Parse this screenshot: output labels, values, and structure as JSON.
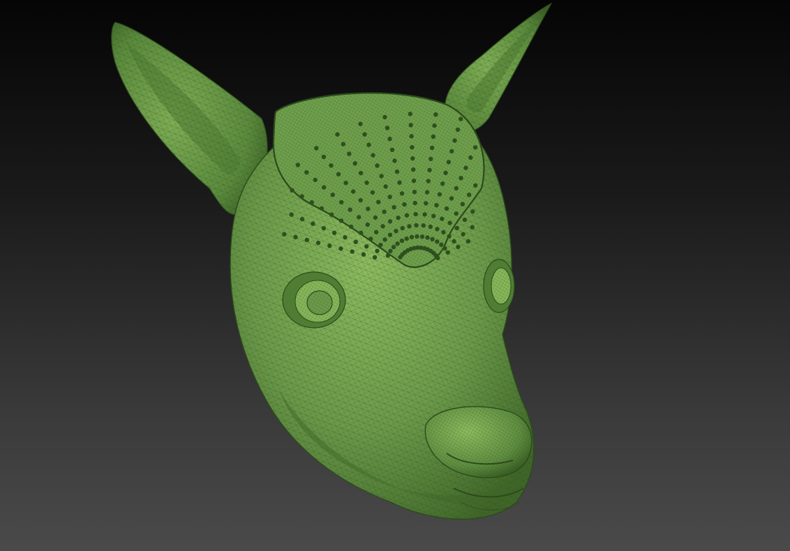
{
  "viewport": {
    "background_top": "#050505",
    "background_bottom": "#4a4a4a"
  },
  "model": {
    "subject": "deer-head-sculpt",
    "material_color": "#6b9a4a",
    "material_shadow": "#3f6628",
    "material_highlight": "#9cc86f",
    "wireframe_color": "#2c4a1c",
    "display_mode": "polyframe"
  }
}
